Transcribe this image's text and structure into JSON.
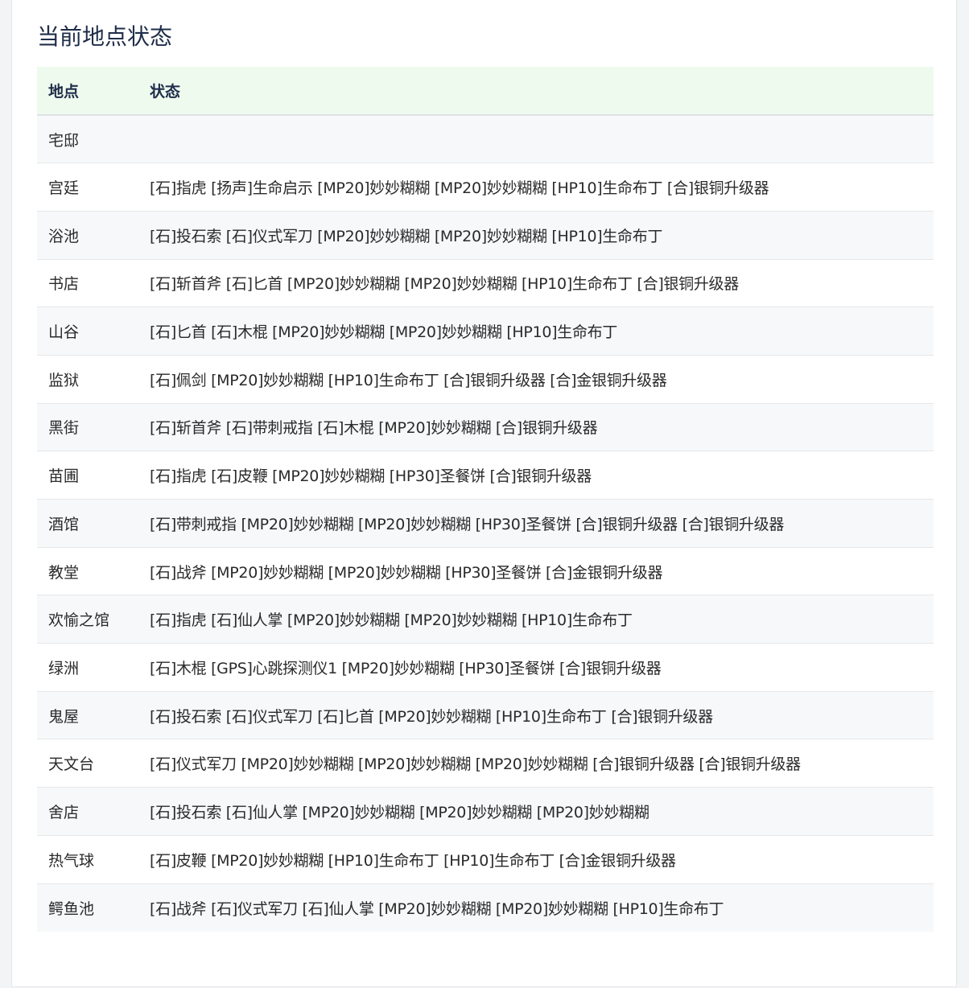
{
  "page": {
    "title": "当前地点状态"
  },
  "table": {
    "headers": [
      "地点",
      "状态"
    ],
    "rows": [
      {
        "location": "宅邸",
        "status": ""
      },
      {
        "location": "宫廷",
        "status": "[石]指虎 [扬声]生命启示 [MP20]妙妙糊糊 [MP20]妙妙糊糊 [HP10]生命布丁 [合]银铜升级器"
      },
      {
        "location": "浴池",
        "status": "[石]投石索 [石]仪式军刀 [MP20]妙妙糊糊 [MP20]妙妙糊糊 [HP10]生命布丁"
      },
      {
        "location": "书店",
        "status": "[石]斩首斧 [石]匕首 [MP20]妙妙糊糊 [MP20]妙妙糊糊 [HP10]生命布丁 [合]银铜升级器"
      },
      {
        "location": "山谷",
        "status": "[石]匕首 [石]木棍 [MP20]妙妙糊糊 [MP20]妙妙糊糊 [HP10]生命布丁"
      },
      {
        "location": "监狱",
        "status": "[石]佩剑 [MP20]妙妙糊糊 [HP10]生命布丁 [合]银铜升级器 [合]金银铜升级器"
      },
      {
        "location": "黑街",
        "status": "[石]斩首斧 [石]带刺戒指 [石]木棍 [MP20]妙妙糊糊 [合]银铜升级器"
      },
      {
        "location": "苗圃",
        "status": "[石]指虎 [石]皮鞭 [MP20]妙妙糊糊 [HP30]圣餐饼 [合]银铜升级器"
      },
      {
        "location": "酒馆",
        "status": "[石]带刺戒指 [MP20]妙妙糊糊 [MP20]妙妙糊糊 [HP30]圣餐饼 [合]银铜升级器 [合]银铜升级器"
      },
      {
        "location": "教堂",
        "status": "[石]战斧 [MP20]妙妙糊糊 [MP20]妙妙糊糊 [HP30]圣餐饼 [合]金银铜升级器"
      },
      {
        "location": "欢愉之馆",
        "status": "[石]指虎 [石]仙人掌 [MP20]妙妙糊糊 [MP20]妙妙糊糊 [HP10]生命布丁"
      },
      {
        "location": "绿洲",
        "status": "[石]木棍 [GPS]心跳探测仪1 [MP20]妙妙糊糊 [HP30]圣餐饼 [合]银铜升级器"
      },
      {
        "location": "鬼屋",
        "status": "[石]投石索 [石]仪式军刀 [石]匕首 [MP20]妙妙糊糊 [HP10]生命布丁 [合]银铜升级器"
      },
      {
        "location": "天文台",
        "status": "[石]仪式军刀 [MP20]妙妙糊糊 [MP20]妙妙糊糊 [MP20]妙妙糊糊 [合]银铜升级器 [合]银铜升级器"
      },
      {
        "location": "舍店",
        "status": "[石]投石索 [石]仙人掌 [MP20]妙妙糊糊 [MP20]妙妙糊糊 [MP20]妙妙糊糊"
      },
      {
        "location": "热气球",
        "status": "[石]皮鞭 [MP20]妙妙糊糊 [HP10]生命布丁 [HP10]生命布丁 [合]金银铜升级器"
      },
      {
        "location": "鳄鱼池",
        "status": "[石]战斧 [石]仪式军刀 [石]仙人掌 [MP20]妙妙糊糊 [MP20]妙妙糊糊 [HP10]生命布丁"
      }
    ]
  }
}
